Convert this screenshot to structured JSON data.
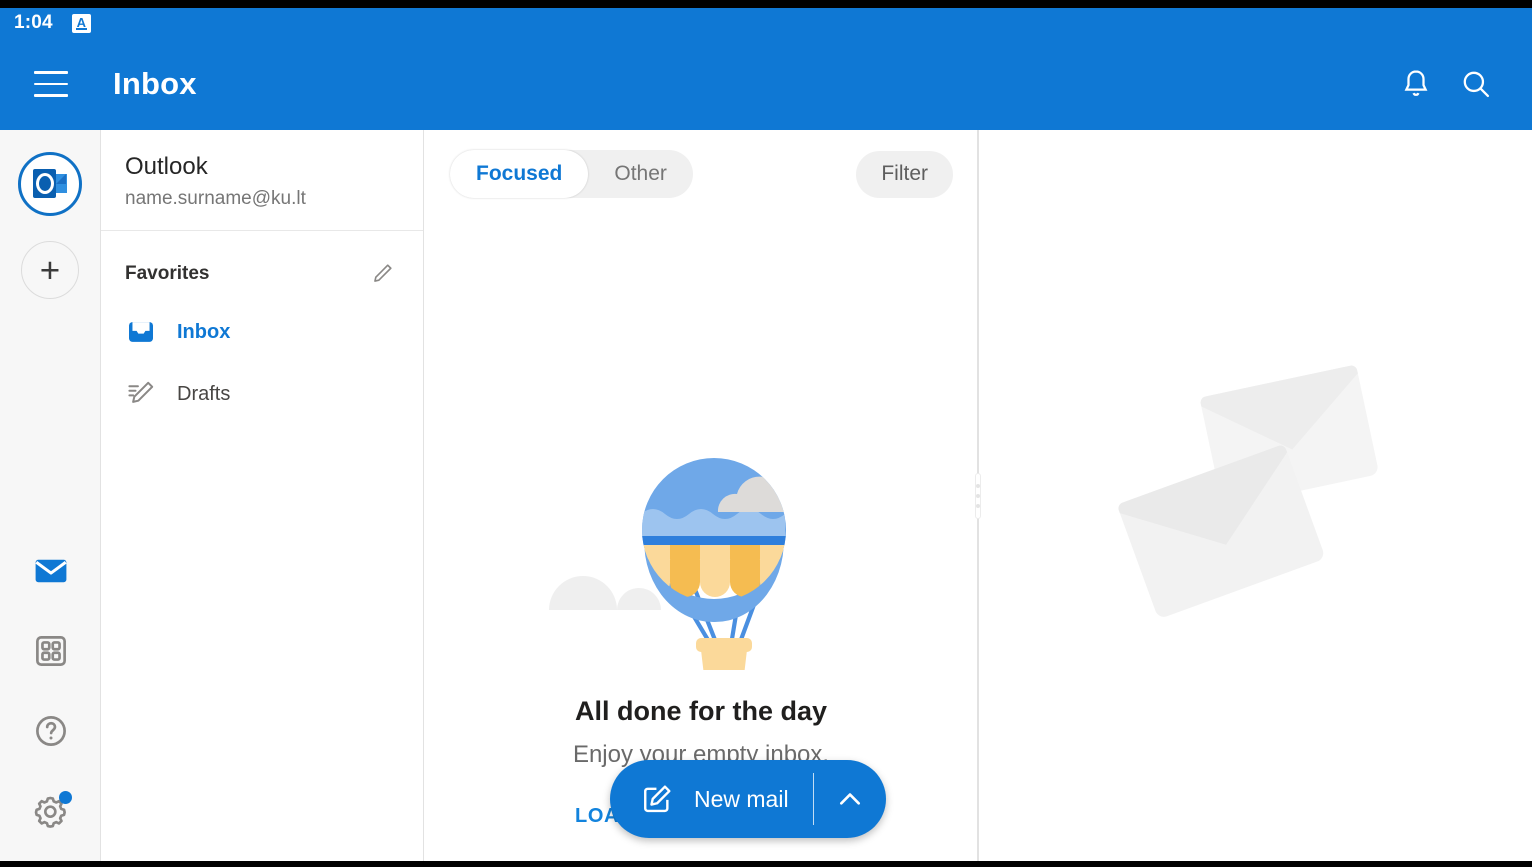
{
  "status_bar": {
    "time": "1:04",
    "app_icon": "outlook-status-icon",
    "app_icon_letter": "A"
  },
  "app_bar": {
    "menu_icon": "hamburger-menu-icon",
    "title": "Inbox",
    "notifications_icon": "bell-icon",
    "search_icon": "search-icon",
    "background_color": "#0f78d4"
  },
  "rail": {
    "account_avatar": "outlook-account-avatar",
    "add_account_label": "+",
    "items": [
      {
        "name": "mail-icon",
        "label": "Mail",
        "active": true
      },
      {
        "name": "apps-grid-icon",
        "label": "Apps",
        "active": false
      },
      {
        "name": "help-icon",
        "label": "Help",
        "active": false
      },
      {
        "name": "settings-gear-icon",
        "label": "Settings",
        "active": false,
        "badge": true
      }
    ]
  },
  "folder_pane": {
    "account_name": "Outlook",
    "account_email": "name.surname@ku.lt",
    "favorites_label": "Favorites",
    "edit_icon": "pencil-edit-icon",
    "folders": [
      {
        "label": "Inbox",
        "icon": "inbox-tray-icon",
        "active": true
      },
      {
        "label": "Drafts",
        "icon": "drafts-pencil-icon",
        "active": false
      }
    ]
  },
  "message_list": {
    "tabs": [
      {
        "label": "Focused",
        "active": true
      },
      {
        "label": "Other",
        "active": false
      }
    ],
    "filter_label": "Filter",
    "empty_state": {
      "illustration": "hot-air-balloon-illustration",
      "title": "All done for the day",
      "subtitle": "Enjoy your empty inbox.",
      "link_label": "LOAD MORE MESSAGES"
    },
    "fab": {
      "compose_icon": "compose-pencil-icon",
      "label": "New mail",
      "expand_icon": "chevron-up-icon"
    }
  },
  "splitter": {
    "handle_icon": "drag-handle-dots-icon"
  },
  "reading_pane": {
    "illustration": "two-envelopes-illustration"
  },
  "colors": {
    "accent": "#0f78d4",
    "link": "#1283dd",
    "rail_bg": "#f7f7f7",
    "divider": "#e2e2e2",
    "balloon_blue": "#6fa8e8",
    "balloon_yellow": "#f5bc51",
    "balloon_cream": "#fbd99a"
  }
}
